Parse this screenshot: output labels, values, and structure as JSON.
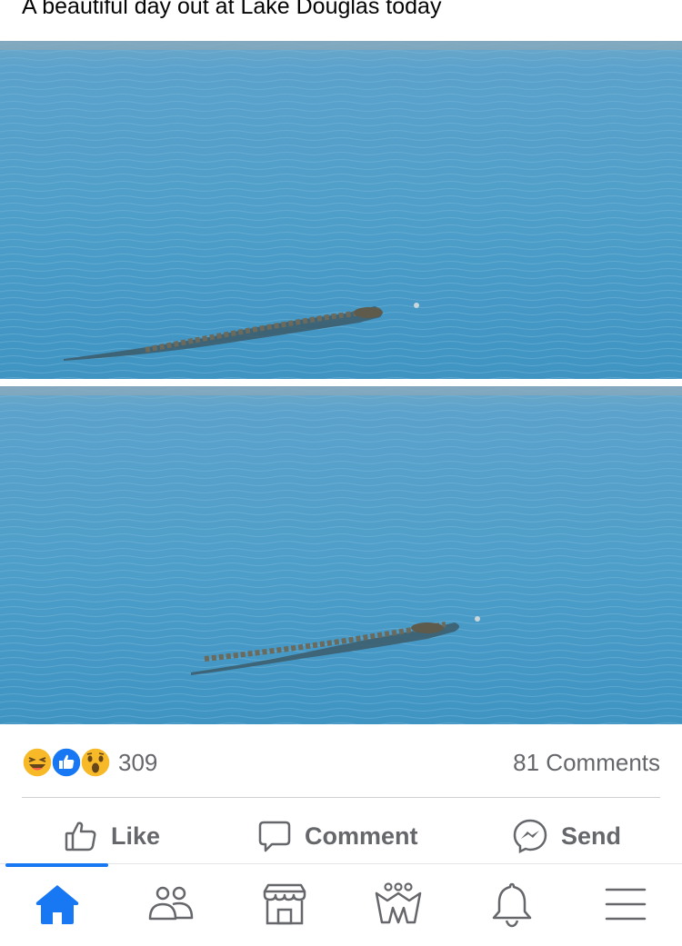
{
  "post": {
    "caption": "A beautiful day out at Lake Douglas today"
  },
  "photos": [
    {
      "name": "lake-photo-1",
      "subject": "alligator-swimming"
    },
    {
      "name": "lake-photo-2",
      "subject": "alligator-swimming"
    }
  ],
  "reactions": {
    "types": [
      "haha-icon",
      "like-icon",
      "wow-icon"
    ],
    "count": "309",
    "comments": "81 Comments"
  },
  "actions": {
    "like": "Like",
    "comment": "Comment",
    "send": "Send"
  },
  "tabbar": {
    "items": [
      "home-icon",
      "friends-icon",
      "marketplace-icon",
      "groups-icon",
      "notifications-icon",
      "menu-icon"
    ],
    "active": "home-icon"
  },
  "colors": {
    "accent": "#1877f2",
    "secondary_text": "#65676b",
    "water": "#4a9cc6"
  }
}
